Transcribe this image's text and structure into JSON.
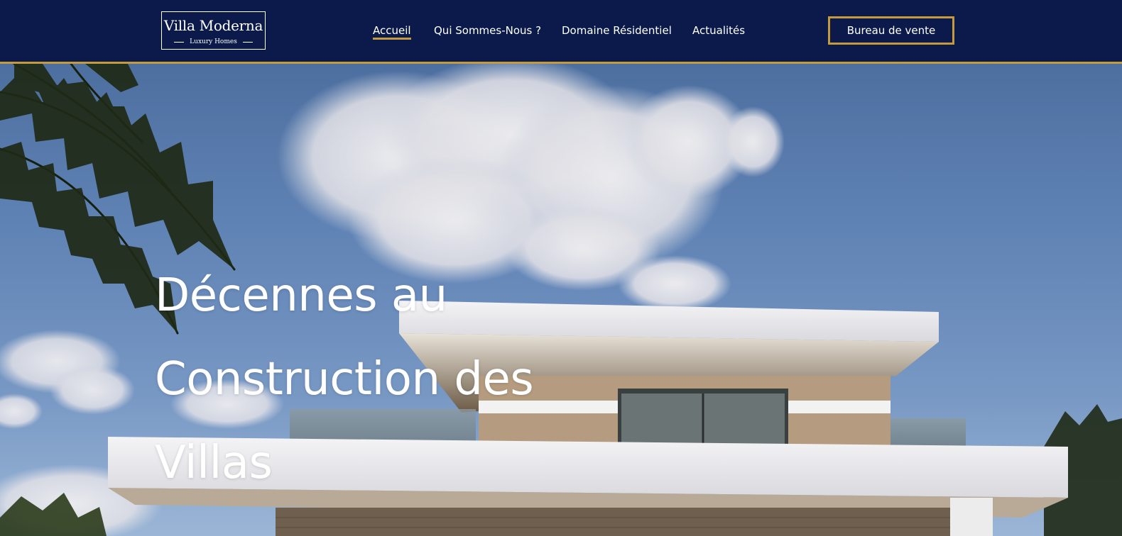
{
  "header": {
    "logo": {
      "title": "Villa Moderna",
      "subtitle": "Luxury Homes"
    },
    "nav": [
      {
        "label": "Accueil",
        "active": true
      },
      {
        "label": "Qui Sommes-Nous ?",
        "active": false
      },
      {
        "label": "Domaine Résidentiel",
        "active": false
      },
      {
        "label": "Actualités",
        "active": false
      }
    ],
    "cta_label": "Bureau de vente"
  },
  "hero": {
    "title_lines": [
      "Décennes au",
      "Construction des",
      "Villas"
    ]
  },
  "colors": {
    "navy": "#0b1a4a",
    "gold": "#c49a3a",
    "white": "#ffffff",
    "sky": "#5a7db0"
  },
  "icons": {
    "logo": "logo-mark"
  }
}
